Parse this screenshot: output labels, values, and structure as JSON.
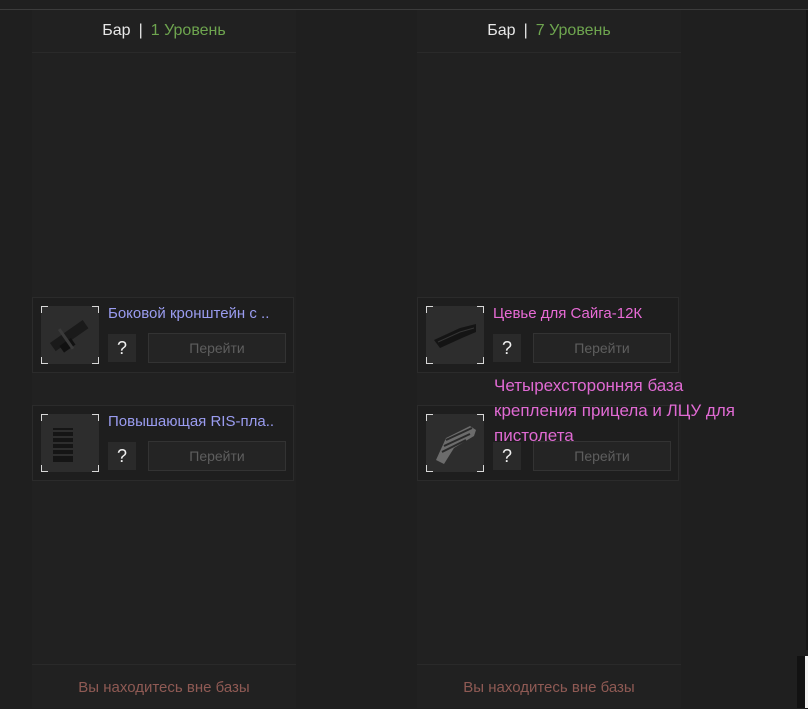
{
  "columns": [
    {
      "header": {
        "label": "Бар",
        "separator": "|",
        "level": "1 Уровень"
      },
      "footer": "Вы находитесь вне базы",
      "items": [
        {
          "title": "Боковой кронштейн с ..",
          "help": "?",
          "go": "Перейти",
          "icon": "side-mount-icon"
        },
        {
          "title": "Повышающая RIS-пла..",
          "help": "?",
          "go": "Перейти",
          "icon": "ris-rail-icon"
        }
      ]
    },
    {
      "header": {
        "label": "Бар",
        "separator": "|",
        "level": "7 Уровень"
      },
      "footer": "Вы находитесь вне базы",
      "items": [
        {
          "title": "Цевье для Сайга-12К",
          "help": "?",
          "go": "Перейти",
          "icon": "handguard-icon"
        },
        {
          "title": "",
          "help": "?",
          "go": "Перейти",
          "icon": "pistol-mount-icon"
        }
      ]
    }
  ],
  "tooltip": {
    "text": "Четырехсторонняя база крепления прицела и ЛЦУ для пистолета"
  },
  "colors": {
    "background": "#1f1f1f",
    "level_green": "#6ea54f",
    "title_blue": "#9a9cf0",
    "title_pink": "#e86bd6",
    "footer_red": "#8f5a54",
    "tooltip_pink": "#e06ad3"
  }
}
